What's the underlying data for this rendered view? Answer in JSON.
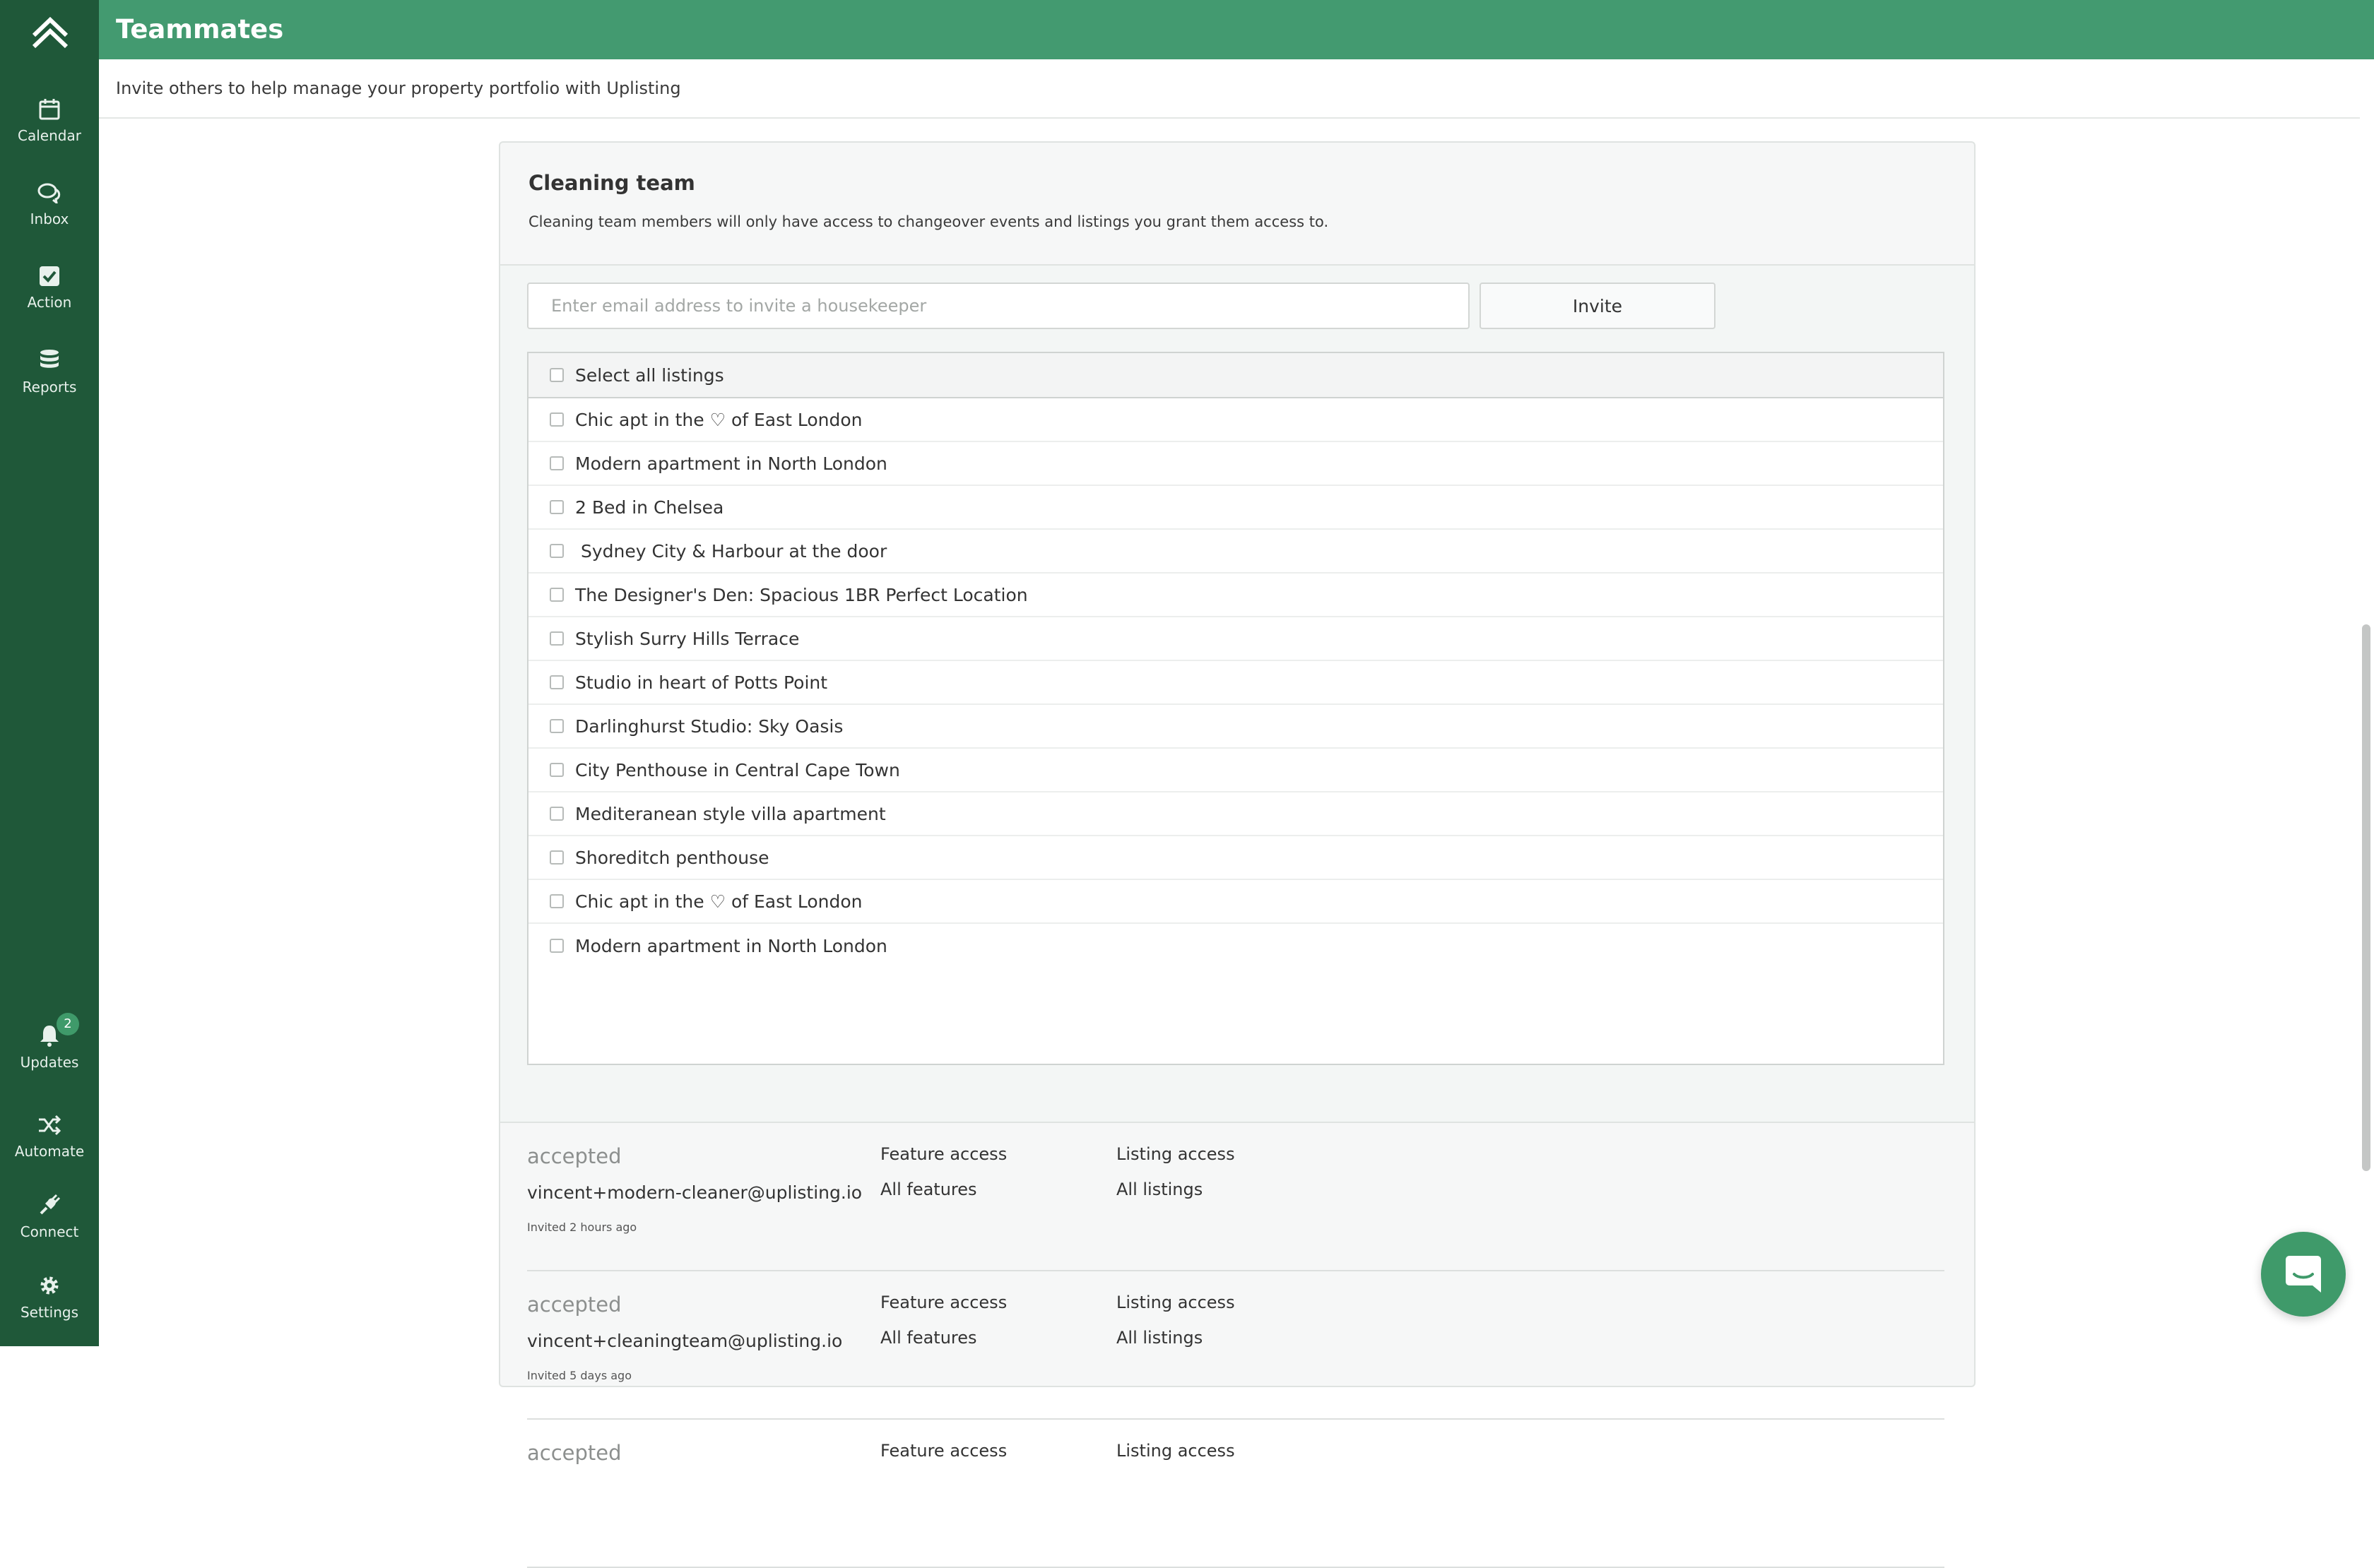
{
  "app": {
    "title": "Teammates",
    "subtitle": "Invite others to help manage your property portfolio with Uplisting",
    "accent_color": "#439a70",
    "sidebar_color": "#1f5839"
  },
  "sidebar": {
    "logo": "uplisting-logo",
    "items": [
      {
        "label": "Calendar",
        "icon": "calendar-icon"
      },
      {
        "label": "Inbox",
        "icon": "chat-bubbles-icon"
      },
      {
        "label": "Action",
        "icon": "checkbox-icon"
      },
      {
        "label": "Reports",
        "icon": "database-icon"
      }
    ],
    "bottom_items": [
      {
        "label": "Updates",
        "icon": "bell-icon",
        "badge": "2"
      },
      {
        "label": "Automate",
        "icon": "shuffle-icon"
      },
      {
        "label": "Connect",
        "icon": "plug-icon"
      },
      {
        "label": "Settings",
        "icon": "gear-icon"
      }
    ]
  },
  "cleaning": {
    "title": "Cleaning team",
    "description": "Cleaning team members will only have access to changeover events and listings you grant them access to.",
    "email_placeholder": "Enter email address to invite a housekeeper",
    "email_value": "",
    "invite_label": "Invite",
    "select_all_label": "Select all listings",
    "listings": [
      "Chic apt in the ♡ of East London",
      "Modern apartment in North London",
      "2 Bed in Chelsea",
      " Sydney City & Harbour at the door",
      "The Designer's Den: Spacious 1BR Perfect Location",
      "Stylish Surry Hills Terrace",
      "Studio in heart of Potts Point",
      "Darlinghurst Studio: Sky Oasis",
      "City Penthouse in Central Cape Town",
      "Mediteranean style villa apartment",
      "Shoreditch penthouse",
      "Chic apt in the ♡ of East London",
      "Modern apartment in North London"
    ]
  },
  "members": [
    {
      "status": "accepted",
      "email": "vincent+modern-cleaner@uplisting.io",
      "invited": "Invited 2 hours ago",
      "feature_header": "Feature access",
      "feature_value": "All features",
      "listing_header": "Listing access",
      "listing_value": "All listings"
    },
    {
      "status": "accepted",
      "email": "vincent+cleaningteam@uplisting.io",
      "invited": "Invited 5 days ago",
      "feature_header": "Feature access",
      "feature_value": "All features",
      "listing_header": "Listing access",
      "listing_value": "All listings"
    },
    {
      "status": "accepted",
      "email": "",
      "invited": "",
      "feature_header": "Feature access",
      "feature_value": "",
      "listing_header": "Listing access",
      "listing_value": ""
    }
  ],
  "chat_widget": {
    "icon": "chat-icon"
  }
}
